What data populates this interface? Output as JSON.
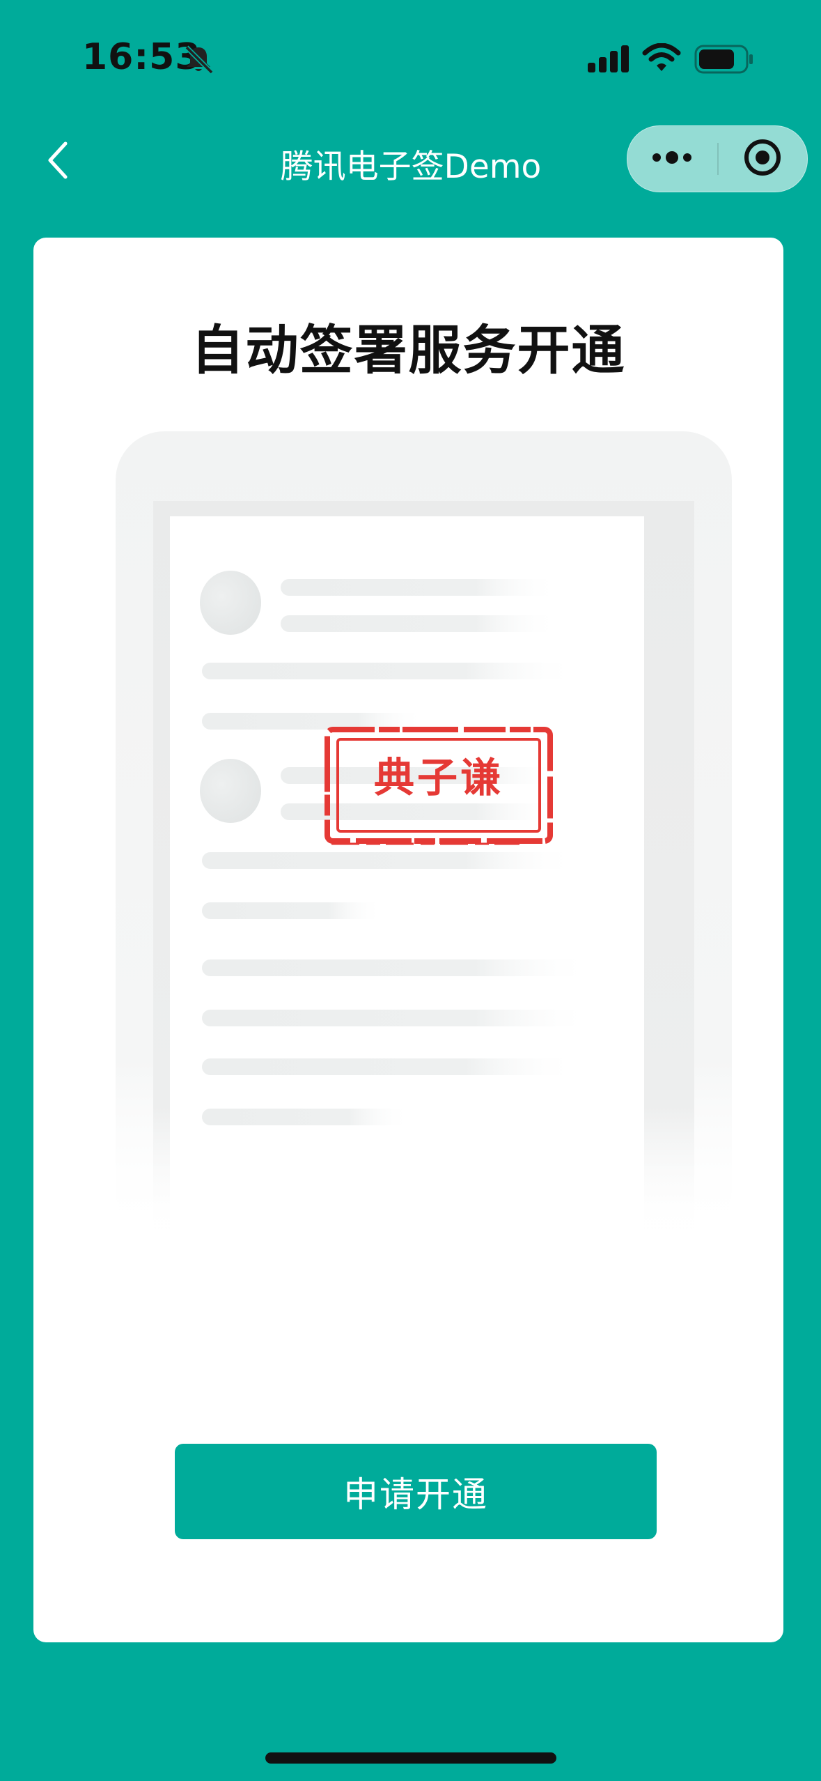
{
  "status_bar": {
    "time": "16:53",
    "icons": [
      "bell-slash-icon",
      "cellular-signal-icon",
      "wifi-icon",
      "battery-icon"
    ]
  },
  "nav": {
    "title": "腾讯电子签Demo",
    "back_icon": "chevron-left-icon",
    "capsule_icons": [
      "more-icon",
      "close-target-icon"
    ]
  },
  "card": {
    "title": "自动签署服务开通",
    "stamp_text": "典子谦",
    "apply_button_label": "申请开通"
  },
  "colors": {
    "brand": "#00AB9A",
    "stamp": "#E53935",
    "card": "#FFFFFF"
  }
}
